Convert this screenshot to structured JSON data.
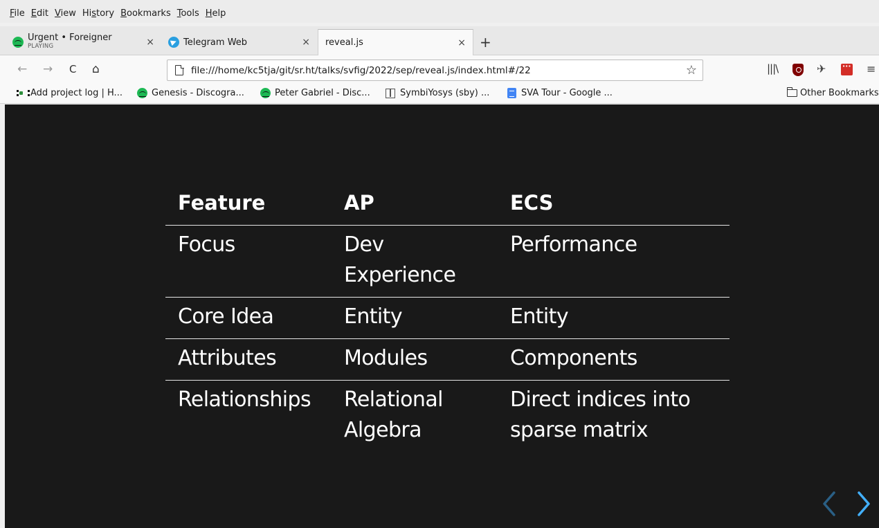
{
  "menubar": {
    "items": [
      {
        "ul": "F",
        "rest": "ile"
      },
      {
        "ul": "E",
        "rest": "dit"
      },
      {
        "ul": "V",
        "rest": "iew"
      },
      {
        "pre": "Hi",
        "ul": "s",
        "rest": "tory"
      },
      {
        "ul": "B",
        "rest": "ookmarks"
      },
      {
        "ul": "T",
        "rest": "ools"
      },
      {
        "ul": "H",
        "rest": "elp"
      }
    ]
  },
  "tabs": [
    {
      "title": "Urgent • Foreigner",
      "subtitle": "PLAYING",
      "icon": "spotify-icon",
      "close": "×"
    },
    {
      "title": "Telegram Web",
      "icon": "telegram-icon",
      "close": "×"
    },
    {
      "title": "reveal.js",
      "close": "×",
      "active": true
    }
  ],
  "new_tab": "+",
  "nav": {
    "back": "←",
    "forward": "→",
    "reload": "C",
    "home": "⌂",
    "url": "file:///home/kc5tja/git/sr.ht/talks/svfig/2022/sep/reveal.js/index.html#/22",
    "star": "☆",
    "library": "|||\\",
    "pin": "✈",
    "menu": "≡"
  },
  "bookmarks": [
    {
      "label": "Add project log | H...",
      "icon": "hackaday-icon"
    },
    {
      "label": "Genesis - Discogra...",
      "icon": "spotify-icon"
    },
    {
      "label": "Peter Gabriel - Disc...",
      "icon": "spotify-icon"
    },
    {
      "label": "SymbiYosys (sby) ...",
      "icon": "book-icon"
    },
    {
      "label": "SVA Tour - Google ...",
      "icon": "document-icon"
    }
  ],
  "other_bookmarks": "Other Bookmarks",
  "slide": {
    "headers": [
      "Feature",
      "AP",
      "ECS"
    ],
    "rows": [
      {
        "c1": "Focus",
        "c2a": "Dev",
        "c2b": "Experience",
        "c3a": "Performance",
        "c3b": ""
      },
      {
        "c1": "Core Idea",
        "c2a": "Entity",
        "c2b": "",
        "c3a": "Entity",
        "c3b": ""
      },
      {
        "c1": "Attributes",
        "c2a": "Modules",
        "c2b": "",
        "c3a": "Components",
        "c3b": ""
      },
      {
        "c1": "Relationships",
        "c2a": "Relational",
        "c2b": "Algebra",
        "c3a": "Direct indices into",
        "c3b": "sparse matrix"
      }
    ]
  },
  "colors": {
    "slide_bg": "#191919",
    "arrow_active": "#42affa",
    "arrow_inactive": "#2a5f85"
  }
}
